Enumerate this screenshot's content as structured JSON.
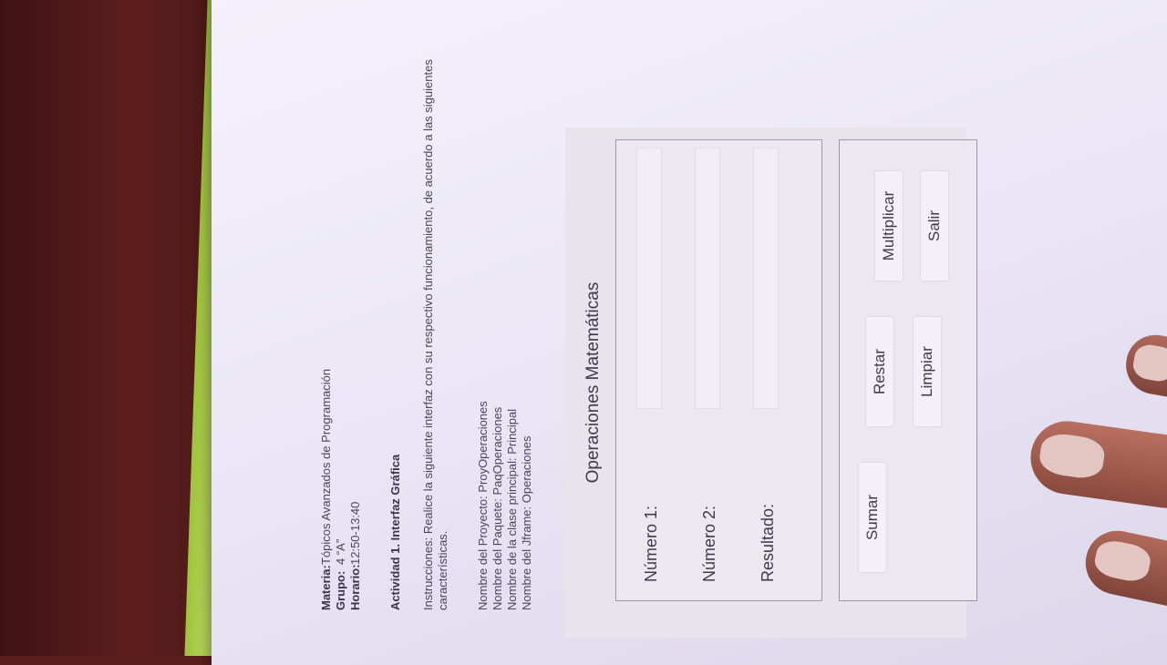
{
  "document": {
    "meta": [
      {
        "key": "Materia:",
        "value": "Tópicos Avanzados de Programación"
      },
      {
        "key": "Grupo:",
        "value": "4 “A”"
      },
      {
        "key": "Horario:",
        "value": "12:50-13:40"
      }
    ],
    "activity_title": "Actividad 1. Interfaz Gráfica",
    "instructions": "Instrucciones: Realice la siguiente interfaz con su respectivo funcionamiento, de acuerdo a las siguientes características.",
    "names": [
      "Nombre del Proyecto: ProyOperaciones",
      "Nombre del Paquete: PaqOperaciones",
      "Nombre de la clase principal: Principal",
      "Nombre del Jframe: Operaciones"
    ]
  },
  "form": {
    "title": "Operaciones Matemáticas",
    "labels": {
      "numero1": "Número 1:",
      "numero2": "Número 2:",
      "resultado": "Resultado:"
    },
    "buttons": {
      "sumar": "Sumar",
      "restar": "Restar",
      "multiplicar": "Multiplicar",
      "limpiar": "Limpiar",
      "salir": "Salir"
    }
  }
}
